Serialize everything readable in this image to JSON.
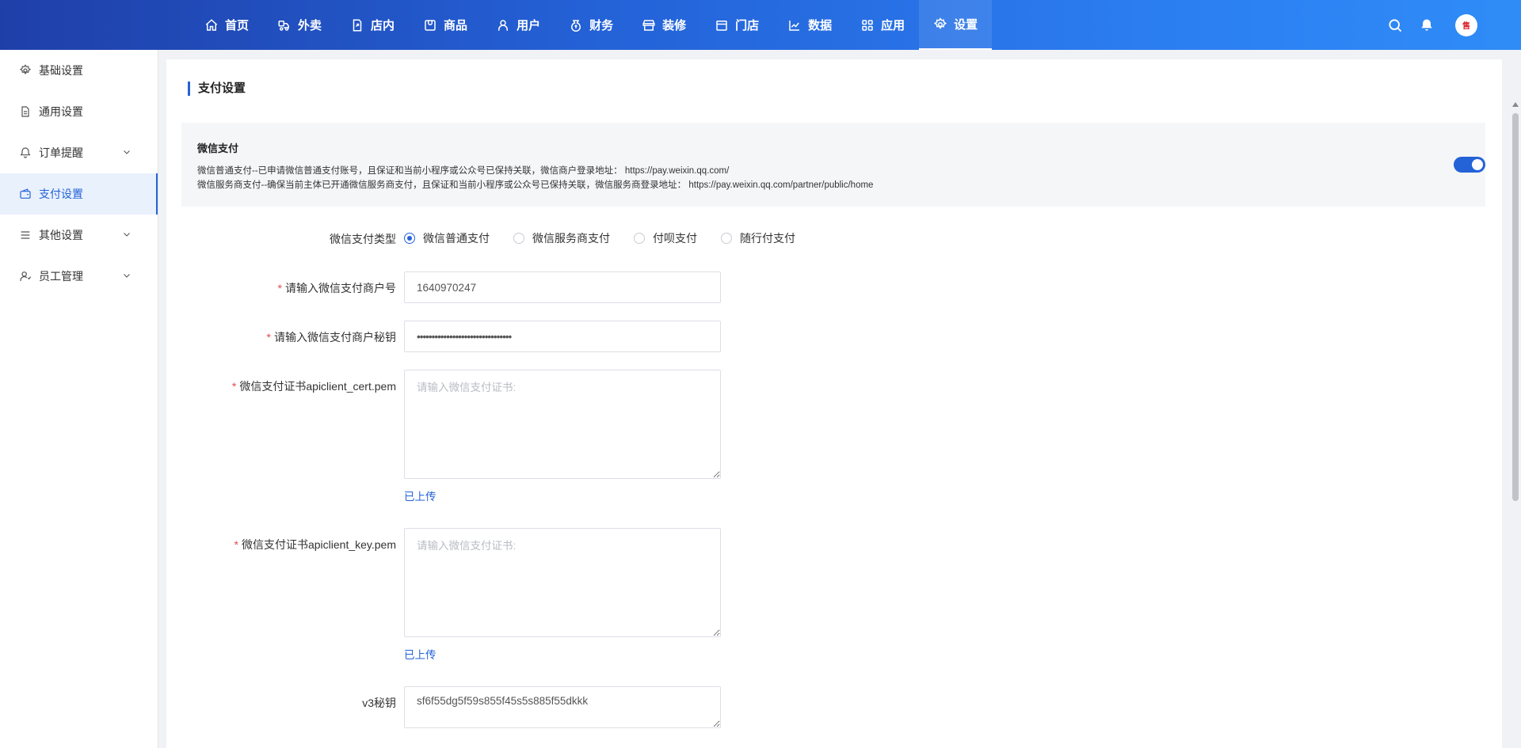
{
  "nav": [
    {
      "label": "首页",
      "icon": "home-icon"
    },
    {
      "label": "外卖",
      "icon": "delivery-icon"
    },
    {
      "label": "店内",
      "icon": "store-inside-icon"
    },
    {
      "label": "商品",
      "icon": "goods-icon"
    },
    {
      "label": "用户",
      "icon": "user-icon"
    },
    {
      "label": "财务",
      "icon": "finance-icon"
    },
    {
      "label": "装修",
      "icon": "shop-decoration-icon"
    },
    {
      "label": "门店",
      "icon": "storefront-icon"
    },
    {
      "label": "数据",
      "icon": "chart-line-icon"
    },
    {
      "label": "应用",
      "icon": "apps-grid-icon"
    },
    {
      "label": "设置",
      "icon": "gear-icon",
      "active": true
    }
  ],
  "topbar": {
    "search_icon": "search-icon",
    "bell_icon": "bell-icon",
    "avatar_text": "售"
  },
  "sidebar": {
    "items": [
      {
        "label": "基础设置",
        "icon": "gear-icon"
      },
      {
        "label": "通用设置",
        "icon": "document-icon"
      },
      {
        "label": "订单提醒",
        "icon": "bell-icon",
        "expandable": true
      },
      {
        "label": "支付设置",
        "icon": "wallet-icon",
        "active": true
      },
      {
        "label": "其他设置",
        "icon": "list-icon",
        "expandable": true
      },
      {
        "label": "员工管理",
        "icon": "staff-icon",
        "expandable": true
      }
    ]
  },
  "page": {
    "title": "支付设置",
    "wechat": {
      "title": "微信支付",
      "line1": "微信普通支付--已申请微信普通支付账号，且保证和当前小程序或公众号已保持关联，微信商户登录地址： https://pay.weixin.qq.com/",
      "line2": "微信服务商支付--确保当前主体已开通微信服务商支付，且保证和当前小程序或公众号已保持关联，微信服务商登录地址： https://pay.weixin.qq.com/partner/public/home",
      "enabled": true
    },
    "form": {
      "pay_type_label": "微信支付类型",
      "pay_type_options": [
        "微信普通支付",
        "微信服务商支付",
        "付呗支付",
        "随行付支付"
      ],
      "pay_type_selected": "微信普通支付",
      "merchant_id_label": "请输入微信支付商户号",
      "merchant_id_value": "1640970247",
      "merchant_secret_label": "请输入微信支付商户秘钥",
      "merchant_secret_value": "••••••••••••••••••••••••••••••••",
      "cert_label": "微信支付证书apiclient_cert.pem",
      "cert_placeholder": "请输入微信支付证书:",
      "cert_status": "已上传",
      "key_label": "微信支付证书apiclient_key.pem",
      "key_placeholder": "请输入微信支付证书:",
      "key_status": "已上传",
      "v3_label": "v3秘钥",
      "v3_value": "sf6f55dg5f59s855f45s5s885f55dkkk",
      "required_mark": "*"
    }
  }
}
